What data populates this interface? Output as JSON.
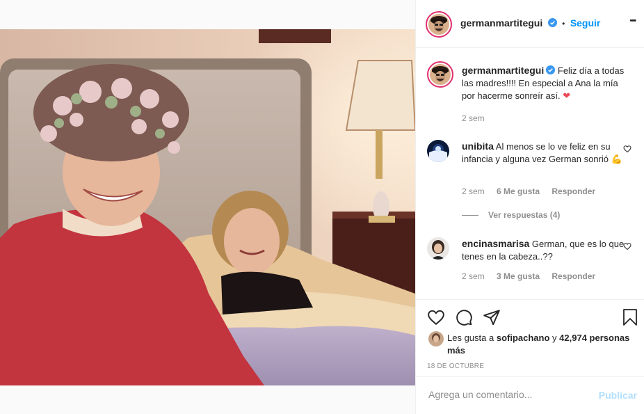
{
  "post": {
    "author": "germanmartitegui",
    "follow_label": "Seguir",
    "follow_sep": "•",
    "more_label": "•••",
    "caption": "Feliz día a todas las madres!!!! En especial a Ana la mía por hacerme sonreír así.",
    "caption_emoji": "❤",
    "caption_time": "2 sem"
  },
  "comments": [
    {
      "user": "unibita",
      "text": "Al menos se lo ve feliz en su infancia y alguna vez German sonrió",
      "emoji": "💪",
      "time": "2 sem",
      "likes": "6 Me gusta",
      "reply_label": "Responder",
      "view_replies": "Ver respuestas (4)"
    },
    {
      "user": "encinasmarisa",
      "text": "German, que es lo que tenes en la cabeza..??",
      "time": "2 sem",
      "likes": "3 Me gusta",
      "reply_label": "Responder"
    }
  ],
  "likes": {
    "prefix": "Les gusta a",
    "user": "sofipachano",
    "conj": "y",
    "count": "42,974 personas más"
  },
  "date": "18 DE OCTUBRE",
  "composer": {
    "placeholder": "Agrega un comentario...",
    "publish_label": "Publicar"
  },
  "colors": {
    "accent": "#0095f6",
    "verified": "#3897f0",
    "heart": "#ed4956",
    "ring": "#e1306c"
  },
  "icons": [
    "verified-badge-icon",
    "heart-icon",
    "comment-icon",
    "share-icon",
    "bookmark-icon",
    "more-options-icon"
  ]
}
